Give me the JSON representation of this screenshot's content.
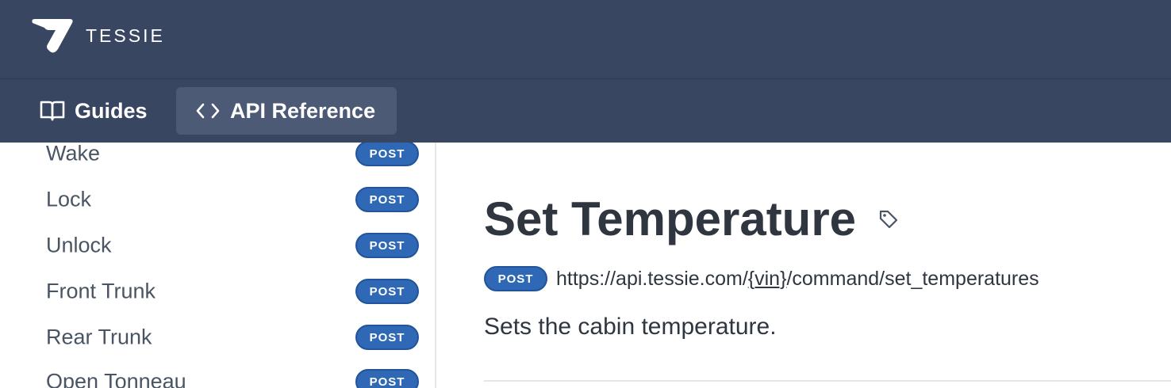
{
  "header": {
    "brand": "TESSIE",
    "logo_icon": "tessie-logo-icon"
  },
  "nav": {
    "items": [
      {
        "label": "Guides",
        "icon": "book-icon",
        "active": false
      },
      {
        "label": "API Reference",
        "icon": "code-icon",
        "active": true
      }
    ]
  },
  "sidebar": {
    "items": [
      {
        "label": "Wake",
        "method": "POST"
      },
      {
        "label": "Lock",
        "method": "POST"
      },
      {
        "label": "Unlock",
        "method": "POST"
      },
      {
        "label": "Front Trunk",
        "method": "POST"
      },
      {
        "label": "Rear Trunk",
        "method": "POST"
      },
      {
        "label": "Open Tonneau",
        "method": "POST"
      }
    ]
  },
  "main": {
    "title": "Set Temperature",
    "tag_icon": "tag-icon",
    "method": "POST",
    "url_prefix": "https://api.tessie.com/",
    "url_param": "{vin}",
    "url_suffix": "/command/set_temperatures",
    "description": "Sets the cabin temperature."
  },
  "colors": {
    "header_bg": "#384662",
    "active_tab_bg": "#4c5a76",
    "post_badge": "#2f68b5",
    "text": "#2f3640"
  }
}
